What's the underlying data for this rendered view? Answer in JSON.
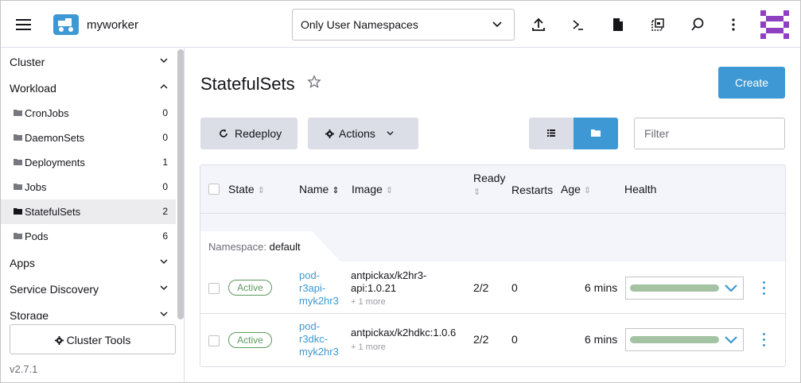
{
  "header": {
    "app_name": "myworker",
    "namespace_select": "Only User Namespaces",
    "icons": [
      "menu-icon",
      "upload-icon",
      "terminal-icon",
      "file-icon",
      "copy-config-icon",
      "search-icon",
      "more-vertical-icon",
      "avatar"
    ]
  },
  "sidebar": {
    "groups": {
      "cluster": "Cluster",
      "workload": "Workload",
      "apps": "Apps",
      "service_discovery": "Service Discovery",
      "storage": "Storage"
    },
    "items": [
      {
        "label": "CronJobs",
        "count": "0"
      },
      {
        "label": "DaemonSets",
        "count": "0"
      },
      {
        "label": "Deployments",
        "count": "1"
      },
      {
        "label": "Jobs",
        "count": "0"
      },
      {
        "label": "StatefulSets",
        "count": "2"
      },
      {
        "label": "Pods",
        "count": "6"
      }
    ],
    "active_item": "StatefulSets",
    "cluster_tools": "Cluster Tools",
    "version": "v2.7.1"
  },
  "main": {
    "title": "StatefulSets",
    "create": "Create",
    "redeploy": "Redeploy",
    "actions": "Actions",
    "filter_placeholder": "Filter",
    "view_toggle": {
      "list": "list-icon",
      "folder": "folder-icon",
      "selected": "folder"
    }
  },
  "table": {
    "columns": {
      "state": "State",
      "name": "Name",
      "image": "Image",
      "ready": "Ready",
      "restarts": "Restarts",
      "age": "Age",
      "health": "Health"
    },
    "group": {
      "label": "Namespace:",
      "value": "default"
    },
    "rows": [
      {
        "state": "Active",
        "name_lines": [
          "pod-",
          "r3api-",
          "myk2hr3"
        ],
        "image_lines": [
          "antpickax/k2hr3-",
          "api:1.0.21"
        ],
        "more": "+ 1 more",
        "ready": "2/2",
        "restarts": "0",
        "age": "6 mins"
      },
      {
        "state": "Active",
        "name_lines": [
          "pod-",
          "r3dkc-",
          "myk2hr3"
        ],
        "image_lines": [
          "antpickax/k2hdkc:1.0.6"
        ],
        "more": "+ 1 more",
        "ready": "2/2",
        "restarts": "0",
        "age": "6 mins"
      }
    ]
  },
  "colors": {
    "primary": "#3d98d3",
    "active_badge": "#5d995d",
    "health_bar": "#a3c3a3",
    "button_gray": "#dcdee7",
    "avatar": "#8e3fc2"
  }
}
